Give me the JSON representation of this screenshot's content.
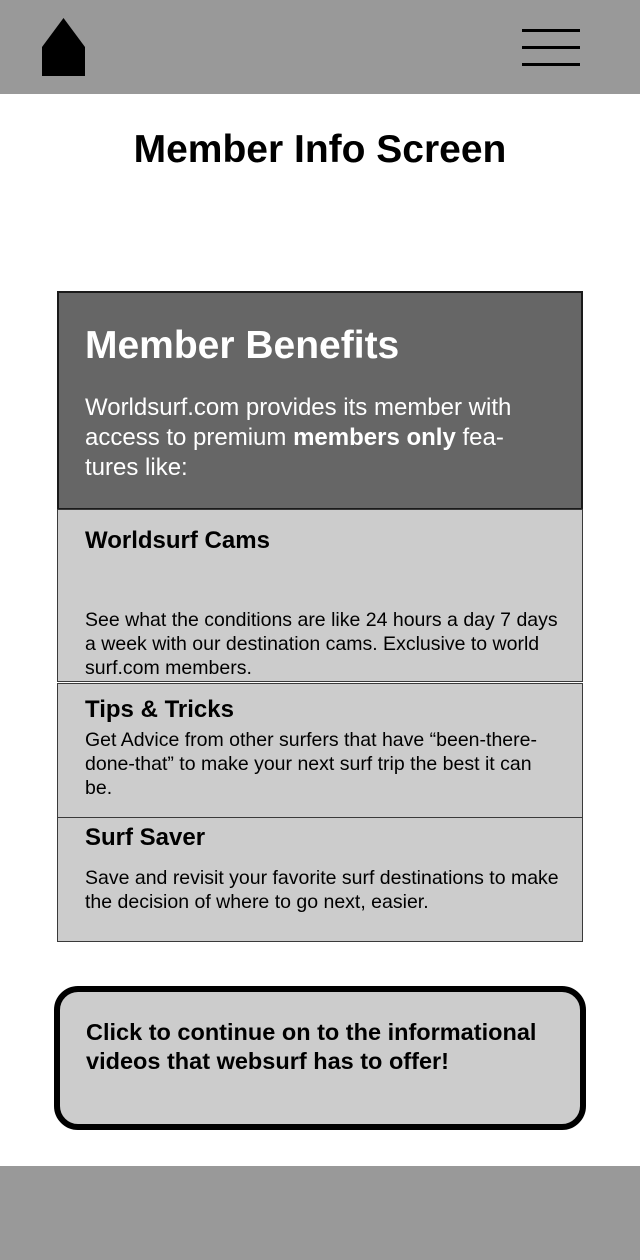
{
  "header": {
    "home_icon": "home-icon",
    "menu_icon": "hamburger-menu-icon"
  },
  "page": {
    "title": "Member Info Screen"
  },
  "benefits": {
    "title": "Member Benefits",
    "desc_before": "Worldsurf.com provides its member with access to premium ",
    "desc_bold": "members only",
    "desc_after": " fea-tures like:",
    "features": [
      {
        "title": "Worldsurf Cams",
        "text": "See what the conditions are like 24 hours a day 7 days a week with our destination cams. Exclusive to world surf.com members."
      },
      {
        "title": "Tips & Tricks",
        "text": "Get Advice from other surfers that have “been-there-done-that” to make your next surf trip the best it can be."
      },
      {
        "title": "Surf Saver",
        "text": "Save and revisit your favorite surf destinations to make the decision of where to go next, easier."
      }
    ]
  },
  "cta": {
    "label": "Click to continue on to the informational videos that websurf has to offer!"
  },
  "colors": {
    "header_bg": "#999999",
    "hero_bg": "#666666",
    "card_bg": "#cccccc",
    "text": "#000000"
  }
}
